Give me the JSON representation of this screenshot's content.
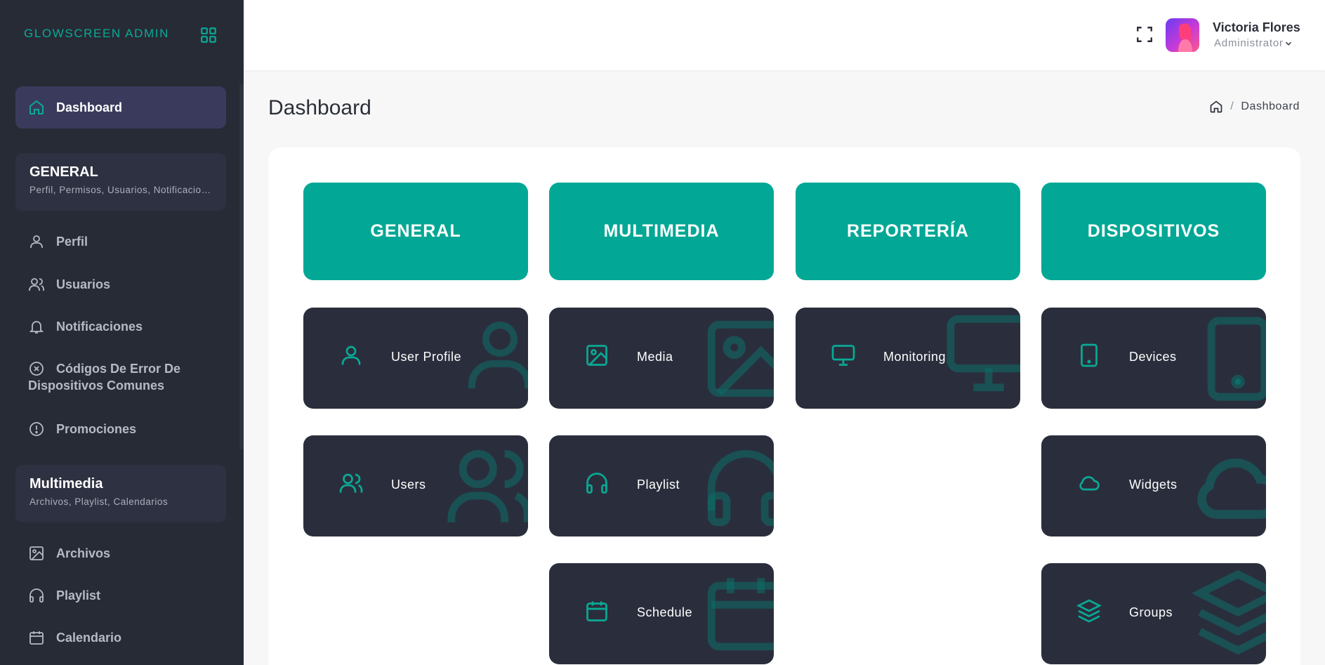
{
  "brand": "GLOWSCREEN ADMIN",
  "colors": {
    "accent": "#02a895",
    "sidebar_bg": "#272b36",
    "tile_bg": "#2a2e3c",
    "active_nav_bg": "#3a3b5c"
  },
  "sidebar": {
    "dashboard_label": "Dashboard",
    "general": {
      "title": "GENERAL",
      "subtitle": "Perfil, Permisos, Usuarios, Notificaciones"
    },
    "general_items": [
      {
        "label": "Perfil",
        "icon": "user-icon"
      },
      {
        "label": "Usuarios",
        "icon": "users-icon"
      },
      {
        "label": "Notificaciones",
        "icon": "bell-icon"
      },
      {
        "label": "Códigos De Error De Dispositivos Comunes",
        "icon": "x-circle-icon"
      },
      {
        "label": "Promociones",
        "icon": "alert-circle-icon"
      }
    ],
    "multimedia": {
      "title": "Multimedia",
      "subtitle": "Archivos, Playlist, Calendarios"
    },
    "multimedia_items": [
      {
        "label": "Archivos",
        "icon": "image-icon"
      },
      {
        "label": "Playlist",
        "icon": "headphones-icon"
      },
      {
        "label": "Calendario",
        "icon": "calendar-icon"
      }
    ]
  },
  "topbar": {
    "user_name": "Victoria Flores",
    "user_role": "Administrator"
  },
  "page": {
    "title": "Dashboard",
    "breadcrumb_current": "Dashboard"
  },
  "categories": [
    "GENERAL",
    "MULTIMEDIA",
    "REPORTERÍA",
    "DISPOSITIVOS"
  ],
  "tiles": {
    "general": [
      {
        "label": "User Profile",
        "icon": "user-icon"
      },
      {
        "label": "Users",
        "icon": "users-icon"
      }
    ],
    "multimedia": [
      {
        "label": "Media",
        "icon": "image-icon"
      },
      {
        "label": "Playlist",
        "icon": "headphones-icon"
      },
      {
        "label": "Schedule",
        "icon": "calendar-icon"
      }
    ],
    "reporteria": [
      {
        "label": "Monitoring",
        "icon": "monitor-icon"
      }
    ],
    "dispositivos": [
      {
        "label": "Devices",
        "icon": "tablet-icon"
      },
      {
        "label": "Widgets",
        "icon": "cloud-icon"
      },
      {
        "label": "Groups",
        "icon": "layers-icon"
      }
    ]
  }
}
